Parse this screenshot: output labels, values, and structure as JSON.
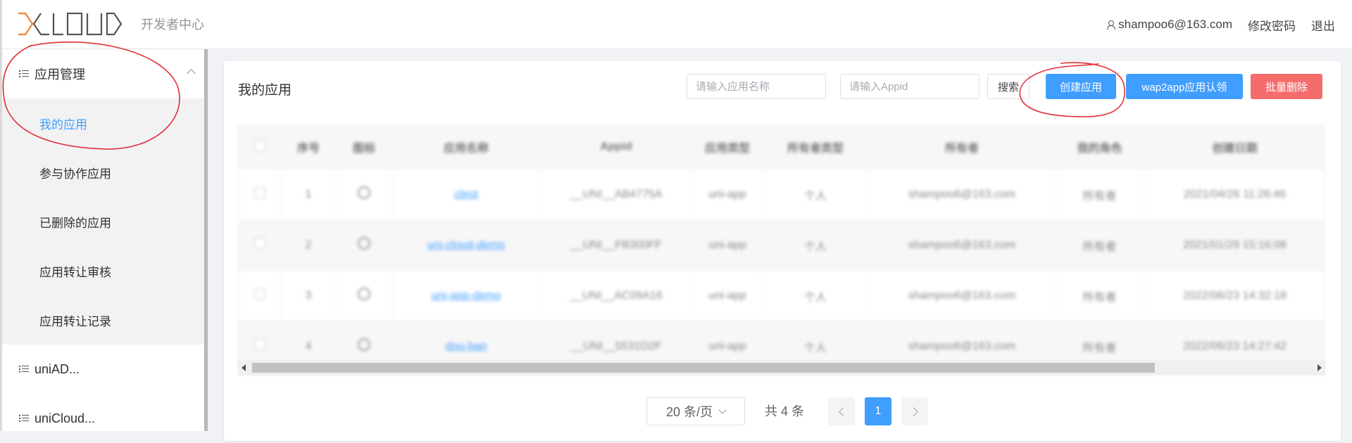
{
  "header": {
    "logo_text": "DCLOUD",
    "subtitle": "开发者中心",
    "user_email": "shampoo6@163.com",
    "change_password": "修改密码",
    "logout": "退出"
  },
  "sidebar": {
    "groups": [
      {
        "label": "应用管理",
        "expanded": true,
        "items": [
          {
            "label": "我的应用",
            "active": true
          },
          {
            "label": "参与协作应用"
          },
          {
            "label": "已删除的应用"
          },
          {
            "label": "应用转让审核"
          },
          {
            "label": "应用转让记录"
          }
        ]
      },
      {
        "label": "uniAD..."
      },
      {
        "label": "uniCloud..."
      }
    ]
  },
  "main": {
    "title": "我的应用",
    "search_name_placeholder": "请输入应用名称",
    "search_appid_placeholder": "请输入Appid",
    "search_button": "搜索",
    "create_button": "创建应用",
    "wap2app_button": "wap2app应用认领",
    "batch_delete_button": "批量删除",
    "table": {
      "columns": [
        "",
        "序号",
        "图标",
        "应用名称",
        "Appid",
        "应用类型",
        "所有者类型",
        "所有者",
        "我的角色",
        "创建日期"
      ],
      "rows": [
        {
          "index": "1",
          "name": "cleot",
          "appid": "__UNI__AB4775A",
          "type": "uni-app",
          "owner_type": "个人",
          "owner": "shampoo6@163.com",
          "role": "所有者",
          "created": "2021/04/26 11:26:46"
        },
        {
          "index": "2",
          "name": "uni-cloud-demo",
          "appid": "__UNI__FB300FF",
          "type": "uni-app",
          "owner_type": "个人",
          "owner": "shampoo6@163.com",
          "role": "所有者",
          "created": "2021/01/29 15:16:08"
        },
        {
          "index": "3",
          "name": "uni-app-demo",
          "appid": "__UNI__AC09A16",
          "type": "uni-app",
          "owner_type": "个人",
          "owner": "shampoo6@163.com",
          "role": "所有者",
          "created": "2022/06/23 14:32:18"
        },
        {
          "index": "4",
          "name": "dou-ban",
          "appid": "__UNI__5531D2F",
          "type": "uni-app",
          "owner_type": "个人",
          "owner": "shampoo6@163.com",
          "role": "所有者",
          "created": "2022/06/23 14:27:42"
        }
      ]
    },
    "pagination": {
      "page_size": "20 条/页",
      "total": "共 4 条",
      "current_page": "1"
    }
  },
  "colors": {
    "primary": "#409eff",
    "danger": "#f56c6c",
    "logo_orange": "#f08a3e",
    "annotation_red": "#e0303a"
  }
}
